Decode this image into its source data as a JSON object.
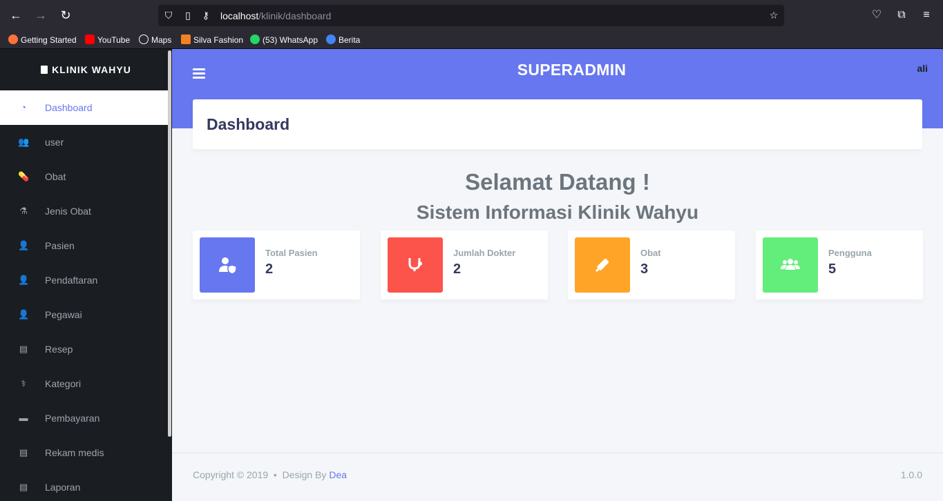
{
  "browser": {
    "url_host": "localhost",
    "url_path": "/klinik/dashboard",
    "bookmarks": [
      {
        "label": "Getting Started",
        "color": "#ff7139"
      },
      {
        "label": "YouTube",
        "color": "#ff0000"
      },
      {
        "label": "Maps",
        "color": "#fbfbfe"
      },
      {
        "label": "Silva Fashion",
        "color": "#f48024"
      },
      {
        "label": "(53) WhatsApp",
        "color": "#25d366"
      },
      {
        "label": "Berita",
        "color": "#4285f4"
      }
    ]
  },
  "sidebar": {
    "brand": "KLINIK WAHYU",
    "items": [
      {
        "label": "Dashboard",
        "icon": "tachometer-icon",
        "glyph": "◔",
        "active": true
      },
      {
        "label": "user",
        "icon": "users-icon",
        "glyph": "👥"
      },
      {
        "label": "Obat",
        "icon": "pills-icon",
        "glyph": "💊"
      },
      {
        "label": "Jenis Obat",
        "icon": "mortar-pestle-icon",
        "glyph": "⚗"
      },
      {
        "label": "Pasien",
        "icon": "user-shield-icon",
        "glyph": "👤"
      },
      {
        "label": "Pendaftaran",
        "icon": "user-plus-icon",
        "glyph": "👤"
      },
      {
        "label": "Pegawai",
        "icon": "user-tie-icon",
        "glyph": "👤"
      },
      {
        "label": "Resep",
        "icon": "file-icon",
        "glyph": "▤"
      },
      {
        "label": "Kategori",
        "icon": "stethoscope-icon",
        "glyph": "⚕"
      },
      {
        "label": "Pembayaran",
        "icon": "money-icon",
        "glyph": "▬"
      },
      {
        "label": "Rekam medis",
        "icon": "file-medical-icon",
        "glyph": "▤"
      },
      {
        "label": "Laporan",
        "icon": "file-alt-icon",
        "glyph": "▤"
      }
    ]
  },
  "header": {
    "title": "SUPERADMIN",
    "user": "ali"
  },
  "page": {
    "section_title": "Dashboard",
    "welcome": "Selamat Datang !",
    "subtitle": "Sistem Informasi Klinik Wahyu"
  },
  "cards": [
    {
      "label": "Total Pasien",
      "value": "2",
      "color": "#6777ef",
      "icon": "user-shield-icon"
    },
    {
      "label": "Jumlah Dokter",
      "value": "2",
      "color": "#fc544b",
      "icon": "stethoscope-icon"
    },
    {
      "label": "Obat",
      "value": "3",
      "color": "#ffa426",
      "icon": "syringe-icon"
    },
    {
      "label": "Pengguna",
      "value": "5",
      "color": "#63ed7a",
      "icon": "users-icon"
    }
  ],
  "footer": {
    "copyright": "Copyright © 2019",
    "design_by": "Design By",
    "author": "Dea",
    "version": "1.0.0"
  }
}
